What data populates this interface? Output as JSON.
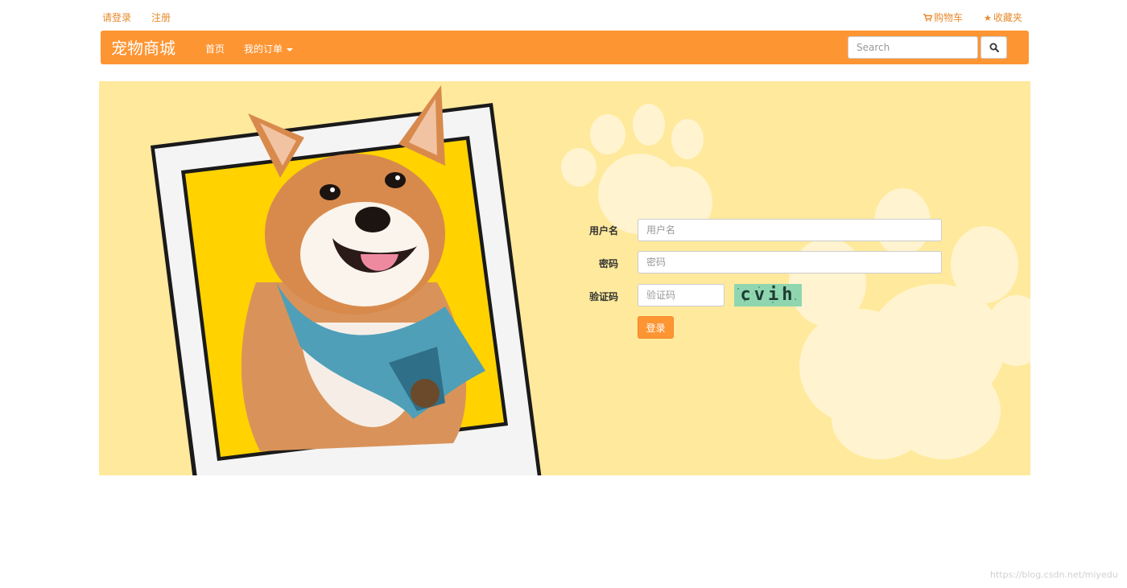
{
  "topbar": {
    "login_link": "请登录",
    "register_link": "注册",
    "cart_link": "购物车",
    "favorites_link": "收藏夹",
    "cart_icon": "shopping-cart-icon",
    "favorites_icon": "star-icon"
  },
  "navbar": {
    "brand": "宠物商城",
    "home": "首页",
    "my_orders": "我的订单",
    "search_placeholder": "Search",
    "search_icon": "magnifier-icon"
  },
  "login_form": {
    "username_label": "用户名",
    "username_placeholder": "用户名",
    "password_label": "密码",
    "password_placeholder": "密码",
    "captcha_label": "验证码",
    "captcha_placeholder": "验证码",
    "captcha_text": "cvih",
    "submit_label": "登录"
  },
  "watermark": "https://blog.csdn.net/miyedu",
  "colors": {
    "accent": "#fe9533",
    "link": "#e78a2c",
    "banner_bg": "#ffe99c",
    "photo_bg": "#ffd200"
  }
}
